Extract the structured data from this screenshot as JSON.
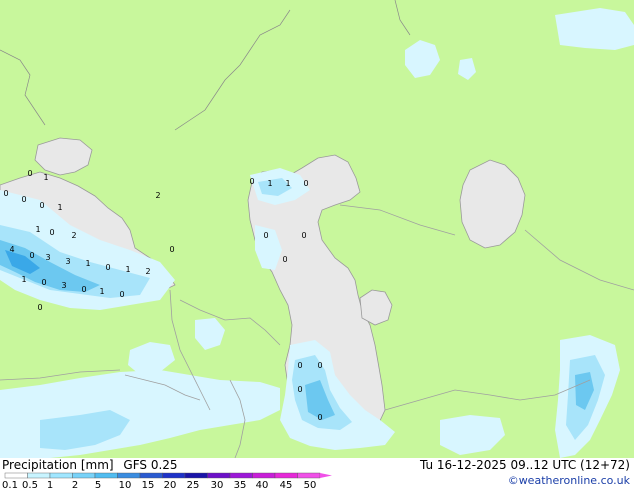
{
  "header": {
    "product_label": "Precipitation [mm]",
    "model_label": "GFS 0.25",
    "valid_time": "Tu 16-12-2025 09..12 UTC (12+72)"
  },
  "credit": "©weatheronline.co.uk",
  "legend": {
    "ticks": [
      "0.1",
      "0.5",
      "1",
      "2",
      "5",
      "10",
      "15",
      "20",
      "25",
      "30",
      "35",
      "40",
      "45",
      "50"
    ],
    "colors": [
      "#ffffff",
      "#c8f4ff",
      "#a0e6ff",
      "#78d2f8",
      "#50bcf0",
      "#3a8ce0",
      "#2a5ad0",
      "#1e32c8",
      "#1a14a8",
      "#6c10c8",
      "#9c18d8",
      "#c81ed8",
      "#e628d8",
      "#f050e8"
    ]
  },
  "map_colors": {
    "land": "#c8f79c",
    "water": "#e8e8e8",
    "precip_light": "#d8f6ff",
    "precip_medium": "#a8e4fa",
    "precip_heavy": "#6cc8f0",
    "precip_strong": "#3aa8e8",
    "border": "#a0a0a0"
  },
  "map_values": [
    "0",
    "1",
    "0",
    "0",
    "0",
    "1",
    "1",
    "0",
    "2",
    "4",
    "0",
    "3",
    "3",
    "1",
    "0",
    "1",
    "2",
    "1",
    "0",
    "3",
    "0",
    "1",
    "0",
    "0",
    "0",
    "2",
    "0",
    "1",
    "1",
    "0",
    "0",
    "0",
    "0",
    "0",
    "0",
    "0",
    "0"
  ]
}
